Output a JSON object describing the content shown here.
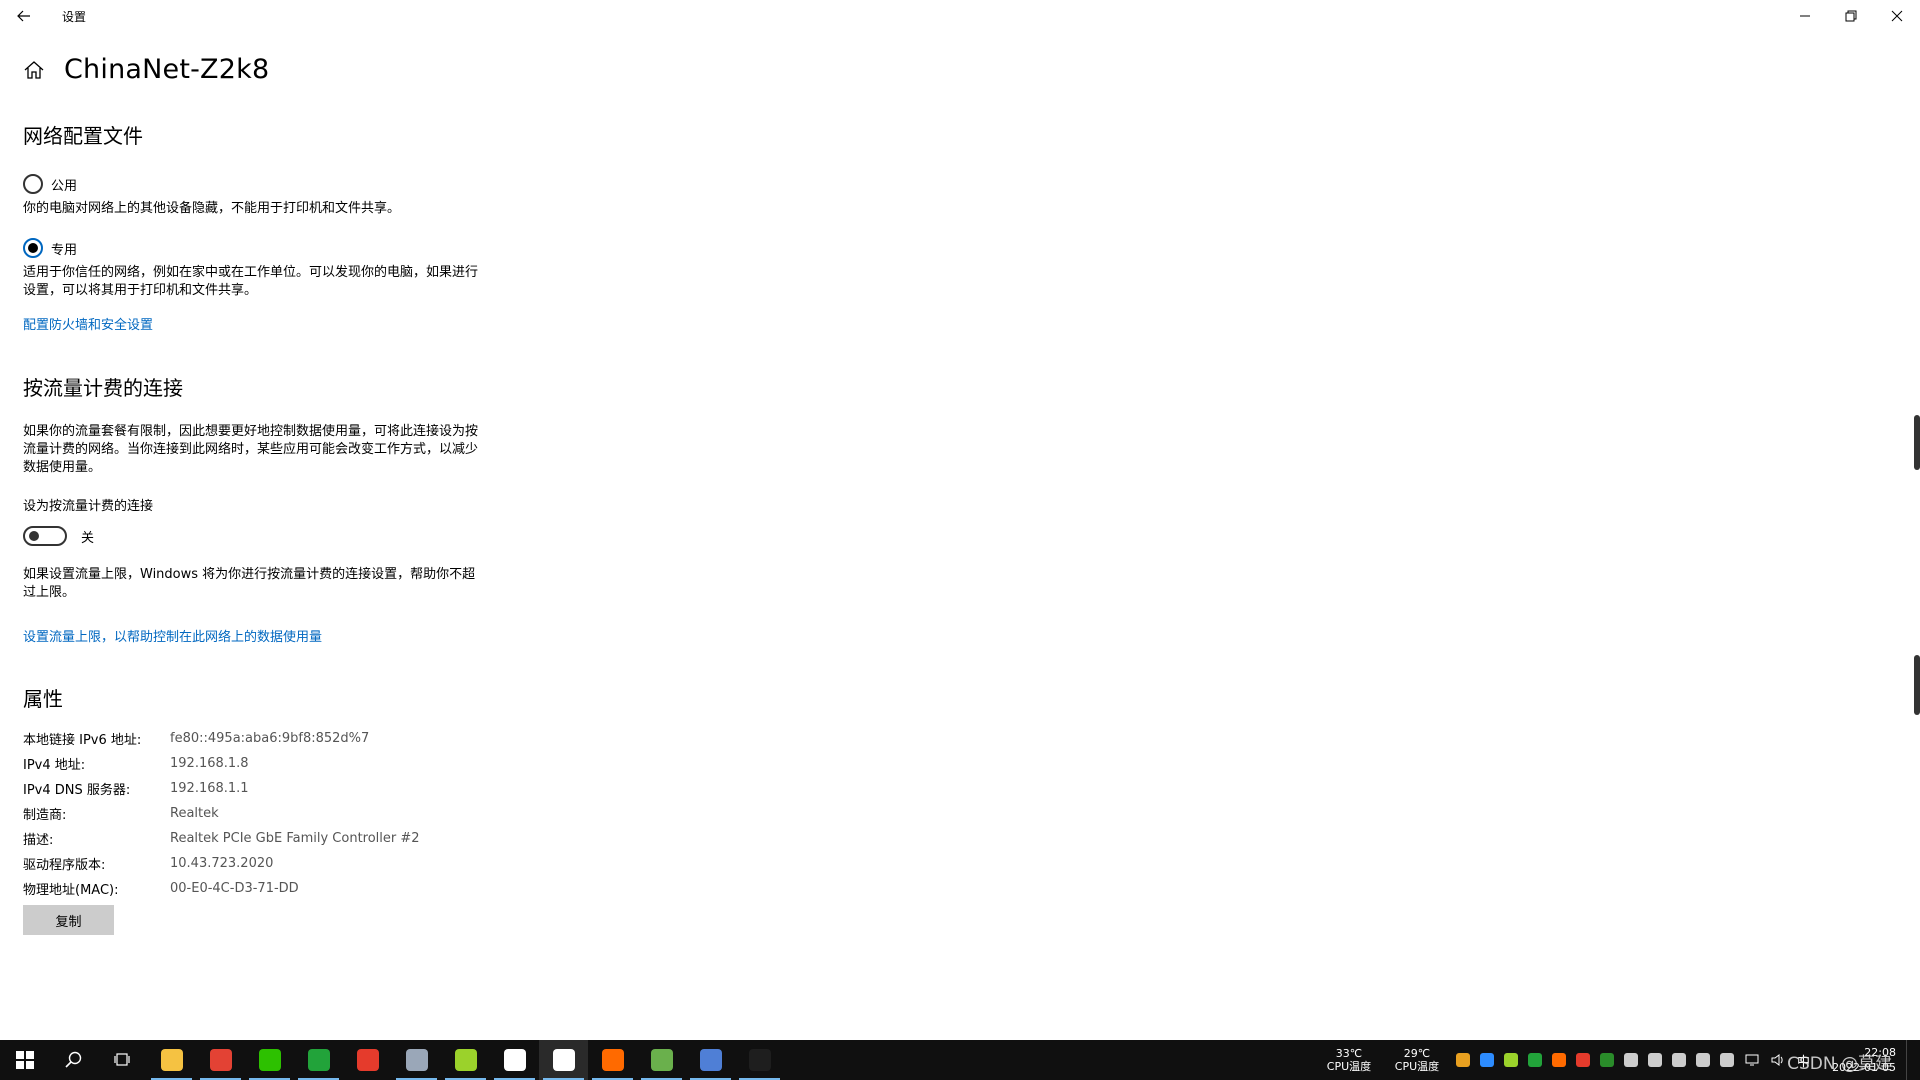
{
  "window": {
    "title": "设置"
  },
  "header": {
    "title": "ChinaNet-Z2k8"
  },
  "profile": {
    "heading": "网络配置文件",
    "public_label": "公用",
    "public_desc": "你的电脑对网络上的其他设备隐藏，不能用于打印机和文件共享。",
    "private_label": "专用",
    "private_desc": "适用于你信任的网络，例如在家中或在工作单位。可以发现你的电脑，如果进行设置，可以将其用于打印机和文件共享。",
    "selected": "专用",
    "firewall_link": "配置防火墙和安全设置"
  },
  "metered": {
    "heading": "按流量计费的连接",
    "desc": "如果你的流量套餐有限制，因此想要更好地控制数据使用量，可将此连接设为按流量计费的网络。当你连接到此网络时，某些应用可能会改变工作方式，以减少数据使用量。",
    "toggle_label": "设为按流量计费的连接",
    "toggle_state": "关",
    "limit_desc": "如果设置流量上限，Windows 将为你进行按流量计费的连接设置，帮助你不超过上限。",
    "limit_link": "设置流量上限，以帮助控制在此网络上的数据使用量"
  },
  "properties": {
    "heading": "属性",
    "rows": [
      {
        "label": "本地链接 IPv6 地址:",
        "value": "fe80::495a:aba6:9bf8:852d%7"
      },
      {
        "label": "IPv4 地址:",
        "value": "192.168.1.8"
      },
      {
        "label": "IPv4 DNS 服务器:",
        "value": "192.168.1.1"
      },
      {
        "label": "制造商:",
        "value": "Realtek"
      },
      {
        "label": "描述:",
        "value": "Realtek PCIe GbE Family Controller #2"
      },
      {
        "label": "驱动程序版本:",
        "value": "10.43.723.2020"
      },
      {
        "label": "物理地址(MAC):",
        "value": "00-E0-4C-D3-71-DD"
      }
    ],
    "copy_button": "复制"
  },
  "taskbar": {
    "apps": [
      {
        "name": "file-explorer-icon",
        "color": "#f5c242",
        "open": true
      },
      {
        "name": "chrome-icon",
        "color": "#e34234",
        "open": true
      },
      {
        "name": "wechat-icon",
        "color": "#2dc100",
        "open": true
      },
      {
        "name": "app-green-circle-icon",
        "color": "#22a33a",
        "open": true
      },
      {
        "name": "app-red-icon",
        "color": "#e53b2c",
        "open": false
      },
      {
        "name": "app-document-icon",
        "color": "#9aa7b8",
        "open": true
      },
      {
        "name": "app-plus-icon",
        "color": "#9bd22b",
        "open": true
      },
      {
        "name": "app-leaf-icon",
        "color": "#ffffff",
        "open": true
      },
      {
        "name": "settings-icon",
        "color": "#ffffff",
        "open": true,
        "active": true
      },
      {
        "name": "search-app-icon",
        "color": "#ff6a00",
        "open": true
      },
      {
        "name": "app-chart-icon",
        "color": "#6ab04c",
        "open": true
      },
      {
        "name": "app-remote-icon",
        "color": "#4f7fd6",
        "open": true
      },
      {
        "name": "terminal-icon",
        "color": "#1e1e1e",
        "open": true
      }
    ],
    "temp1_value": "33℃",
    "temp1_label": "CPU温度",
    "temp2_value": "29℃",
    "temp2_label": "CPU温度",
    "ime": "中",
    "time": "22:08",
    "date": "2022-01-05",
    "watermark": "CSDN @莫建",
    "tray_colors": [
      "#e8a020",
      "#2d8cff",
      "#9bd22b",
      "#22a33a",
      "#ff6a00",
      "#e53b2c",
      "#2a8c2a",
      "#cccccc",
      "#cccccc",
      "#cccccc",
      "#cccccc",
      "#cccccc"
    ]
  }
}
